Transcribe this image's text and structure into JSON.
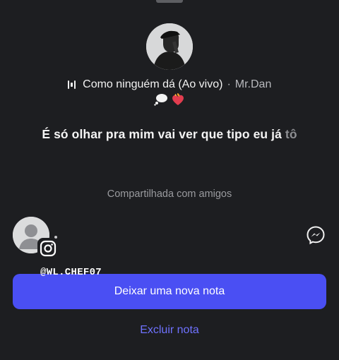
{
  "note": {
    "song_title": "Como ninguém dá (Ao vivo)",
    "separator": "·",
    "artist": "Mr.Dan",
    "emojis": [
      "thought-balloon",
      "heart-on-fire"
    ],
    "lyric_main": "É só olhar pra mim vai ver que tipo eu já ",
    "lyric_fade": "tô"
  },
  "shared_text": "Compartilhada com amigos",
  "user": {
    "handle": "@WL.CHEF07"
  },
  "actions": {
    "primary_label": "Deixar uma nova nota",
    "delete_label": "Excluir nota"
  },
  "colors": {
    "background": "#1d1e21",
    "accent": "#4a4ff3",
    "link": "#6f72ff"
  }
}
